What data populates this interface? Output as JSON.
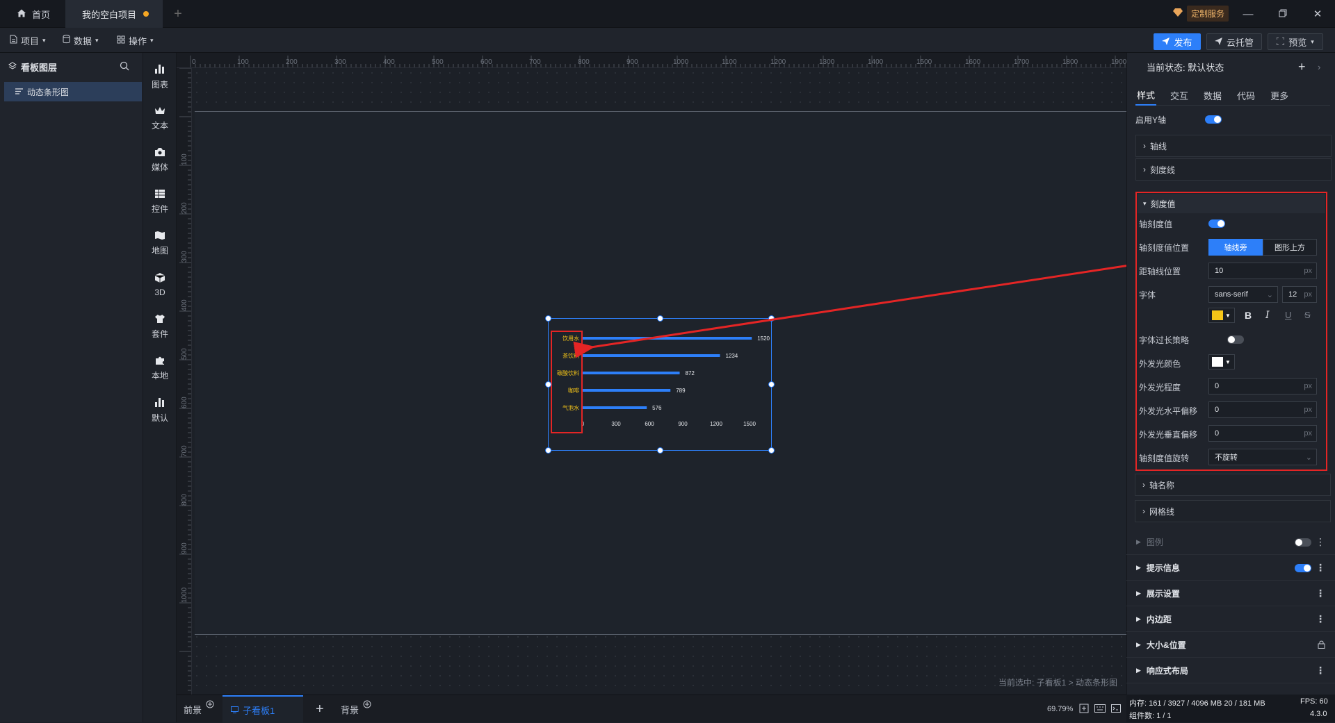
{
  "titlebar": {
    "home": "首页",
    "project": "我的空白项目",
    "custom_service": "定制服务"
  },
  "menubar": {
    "project": "项目",
    "data": "数据",
    "ops": "操作",
    "publish": "发布",
    "cloud": "云托管",
    "preview": "预览"
  },
  "layers": {
    "title": "看板图层",
    "item": "动态条形图"
  },
  "toolbar": [
    "图表",
    "文本",
    "媒体",
    "控件",
    "地图",
    "3D",
    "套件",
    "本地",
    "默认"
  ],
  "ruler": {
    "top": [
      "0",
      "100",
      "200",
      "300",
      "400",
      "500",
      "600",
      "700",
      "800",
      "900",
      "1000",
      "1100",
      "1200",
      "1300",
      "1400",
      "1500",
      "1600",
      "1700",
      "1800",
      "1900"
    ],
    "left": [
      "100",
      "200",
      "300",
      "400",
      "500",
      "600",
      "700",
      "800",
      "900",
      "1000"
    ]
  },
  "chart_data": {
    "type": "bar",
    "orientation": "horizontal",
    "categories": [
      "饮用水",
      "茶饮料",
      "碳酸饮料",
      "咖啡",
      "气泡水"
    ],
    "values": [
      1520,
      1234,
      872,
      789,
      576
    ],
    "xticks": [
      "0",
      "300",
      "600",
      "900",
      "1200",
      "1500"
    ],
    "xlim": [
      0,
      1500
    ],
    "bar_color": "#2d7ff9",
    "label_color": "#f5c518"
  },
  "canvas": {
    "breadcrumb": "当前选中: 子看板1 > 动态条形图"
  },
  "bottom": {
    "front": "前景",
    "board": "子看板1",
    "back": "背景",
    "zoom": "69.79%"
  },
  "panel": {
    "state": "当前状态: 默认状态",
    "tabs": [
      "样式",
      "交互",
      "数据",
      "代码",
      "更多"
    ],
    "enable_y": "启用Y轴",
    "axis_line": "轴线",
    "tick_line": "刻度线",
    "tick_value": "刻度值",
    "axis_tick_value": "轴刻度值",
    "tick_position": "轴刻度值位置",
    "seg_beside": "轴线旁",
    "seg_above": "图形上方",
    "dist": "距轴线位置",
    "dist_value": "10",
    "font": "字体",
    "font_family": "sans-serif",
    "font_size": "12",
    "font_overflow": "字体过长策略",
    "glow_color": "外发光颜色",
    "glow_level": "外发光程度",
    "glow_level_value": "0",
    "glow_h": "外发光水平偏移",
    "glow_h_value": "0",
    "glow_v": "外发光垂直偏移",
    "glow_v_value": "0",
    "rotate": "轴刻度值旋转",
    "rotate_value": "不旋转",
    "axis_name": "轴名称",
    "grid": "网格线",
    "unit": "px"
  },
  "sections": {
    "legend": "图例",
    "tooltip": "提示信息",
    "display": "展示设置",
    "padding": "内边距",
    "size_pos": "大小&位置",
    "responsive": "响应式布局"
  },
  "status": {
    "memory": "内存: 161 / 3927 / 4096 MB  20 / 181 MB",
    "fps": "FPS: 60",
    "components": "组件数: 1 / 1",
    "version": "4.3.0"
  }
}
